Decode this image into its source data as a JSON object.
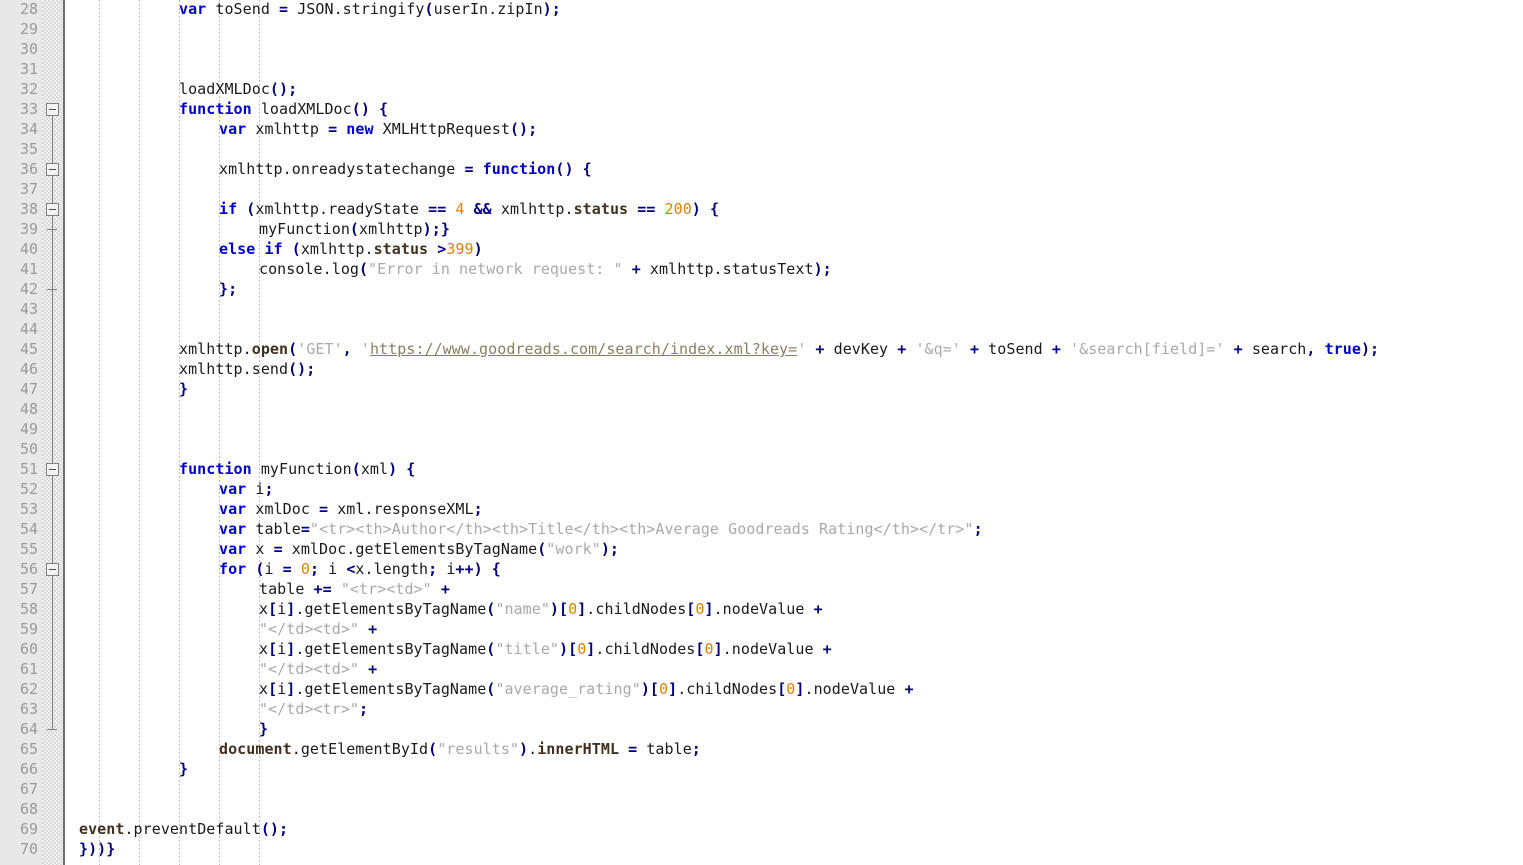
{
  "editor": {
    "kind": "code-editor",
    "language": "javascript",
    "colors": {
      "background": "#ffffff",
      "gutter_background": "#e8e8e8",
      "line_number": "#9a9a9a",
      "keyword": "#0000cc",
      "operator": "#000080",
      "number": "#e08000",
      "string": "#a9a9a9",
      "bold_identifier": "#403020",
      "link": "#8a8060",
      "indent_guide": "#bdbdbd",
      "fold_rail": "#808080"
    },
    "first_line_number": 28,
    "last_line_number": 70,
    "line_height": 20
  },
  "gutter": {
    "line_numbers": [
      28,
      29,
      30,
      31,
      32,
      33,
      34,
      35,
      36,
      37,
      38,
      39,
      40,
      41,
      42,
      43,
      44,
      45,
      46,
      47,
      48,
      49,
      50,
      51,
      52,
      53,
      54,
      55,
      56,
      57,
      58,
      59,
      60,
      61,
      62,
      63,
      64,
      65,
      66,
      67,
      68,
      69,
      70
    ],
    "fold_markers": [
      {
        "line": 33,
        "type": "collapse-box"
      },
      {
        "line": 36,
        "type": "collapse-box"
      },
      {
        "line": 38,
        "type": "collapse-box"
      },
      {
        "line": 39,
        "type": "fold-end-tick"
      },
      {
        "line": 42,
        "type": "fold-end-tick"
      },
      {
        "line": 51,
        "type": "collapse-box"
      },
      {
        "line": 56,
        "type": "collapse-box"
      },
      {
        "line": 64,
        "type": "fold-end-tick"
      }
    ]
  },
  "code": {
    "lines": [
      {
        "n": 28,
        "indent": 0,
        "text": "var toSend = JSON.stringify(userIn.zipIn);"
      },
      {
        "n": 29,
        "indent": 0,
        "text": ""
      },
      {
        "n": 30,
        "indent": 0,
        "text": ""
      },
      {
        "n": 31,
        "indent": 0,
        "text": ""
      },
      {
        "n": 32,
        "indent": 0,
        "text": "loadXMLDoc();"
      },
      {
        "n": 33,
        "indent": 0,
        "text": "function loadXMLDoc() {"
      },
      {
        "n": 34,
        "indent": 1,
        "text": "var xmlhttp = new XMLHttpRequest();"
      },
      {
        "n": 35,
        "indent": 0,
        "text": ""
      },
      {
        "n": 36,
        "indent": 1,
        "text": "xmlhttp.onreadystatechange = function() {"
      },
      {
        "n": 37,
        "indent": 0,
        "text": ""
      },
      {
        "n": 38,
        "indent": 1,
        "text": "if (xmlhttp.readyState == 4 && xmlhttp.status == 200) {"
      },
      {
        "n": 39,
        "indent": 2,
        "text": "myFunction(xmlhttp);}"
      },
      {
        "n": 40,
        "indent": 1,
        "text": "else if (xmlhttp.status >399)"
      },
      {
        "n": 41,
        "indent": 2,
        "text": "console.log(\"Error in network request: \" + xmlhttp.statusText);"
      },
      {
        "n": 42,
        "indent": 1,
        "text": "};"
      },
      {
        "n": 43,
        "indent": 0,
        "text": ""
      },
      {
        "n": 44,
        "indent": 0,
        "text": ""
      },
      {
        "n": 45,
        "indent": 0,
        "text": "xmlhttp.open('GET', 'https://www.goodreads.com/search/index.xml?key=' + devKey + '&q=' + toSend + '&search[field]=' + search, true);"
      },
      {
        "n": 46,
        "indent": 0,
        "text": "xmlhttp.send();"
      },
      {
        "n": 47,
        "indent": 0,
        "text": "}"
      },
      {
        "n": 48,
        "indent": 0,
        "text": ""
      },
      {
        "n": 49,
        "indent": 0,
        "text": ""
      },
      {
        "n": 50,
        "indent": 0,
        "text": ""
      },
      {
        "n": 51,
        "indent": 0,
        "text": "function myFunction(xml) {"
      },
      {
        "n": 52,
        "indent": 1,
        "text": "var i;"
      },
      {
        "n": 53,
        "indent": 1,
        "text": "var xmlDoc = xml.responseXML;"
      },
      {
        "n": 54,
        "indent": 1,
        "text": "var table=\"<tr><th>Author</th><th>Title</th><th>Average Goodreads Rating</th></tr>\";"
      },
      {
        "n": 55,
        "indent": 1,
        "text": "var x = xmlDoc.getElementsByTagName(\"work\");"
      },
      {
        "n": 56,
        "indent": 1,
        "text": "for (i = 0; i <x.length; i++) {"
      },
      {
        "n": 57,
        "indent": 2,
        "text": "table += \"<tr><td>\" +"
      },
      {
        "n": 58,
        "indent": 2,
        "text": "x[i].getElementsByTagName(\"name\")[0].childNodes[0].nodeValue +"
      },
      {
        "n": 59,
        "indent": 2,
        "text": "\"</td><td>\" +"
      },
      {
        "n": 60,
        "indent": 2,
        "text": "x[i].getElementsByTagName(\"title\")[0].childNodes[0].nodeValue +"
      },
      {
        "n": 61,
        "indent": 2,
        "text": "\"</td><td>\" +"
      },
      {
        "n": 62,
        "indent": 2,
        "text": "x[i].getElementsByTagName(\"average_rating\")[0].childNodes[0].nodeValue +"
      },
      {
        "n": 63,
        "indent": 2,
        "text": "\"</td><tr>\";"
      },
      {
        "n": 64,
        "indent": 2,
        "text": "}"
      },
      {
        "n": 65,
        "indent": 1,
        "text": "document.getElementById(\"results\").innerHTML = table;"
      },
      {
        "n": 66,
        "indent": 0,
        "text": "}"
      },
      {
        "n": 67,
        "indent": 0,
        "text": ""
      },
      {
        "n": 68,
        "indent": 0,
        "text": ""
      },
      {
        "n": 69,
        "indent": 0,
        "column": 0,
        "text": "event.preventDefault();"
      },
      {
        "n": 70,
        "indent": 0,
        "column": 0,
        "text": "}))}"
      }
    ]
  },
  "rendered_lines": {
    "l28": [
      [
        "kw",
        "var"
      ],
      [
        "pln",
        " toSend "
      ],
      [
        "op",
        "="
      ],
      [
        "pln",
        " JSON.stringify"
      ],
      [
        "op",
        "("
      ],
      [
        "pln",
        "userIn.zipIn"
      ],
      [
        "op",
        ");"
      ]
    ],
    "l32": [
      [
        "pln",
        "loadXMLDoc"
      ],
      [
        "op",
        "();"
      ]
    ],
    "l33": [
      [
        "kw",
        "function"
      ],
      [
        "pln",
        " loadXMLDoc"
      ],
      [
        "op",
        "()"
      ],
      [
        "pln",
        " "
      ],
      [
        "op",
        "{"
      ]
    ],
    "l34": [
      [
        "kw",
        "var"
      ],
      [
        "pln",
        " xmlhttp "
      ],
      [
        "op",
        "="
      ],
      [
        "pln",
        " "
      ],
      [
        "kw",
        "new"
      ],
      [
        "pln",
        " XMLHttpRequest"
      ],
      [
        "op",
        "();"
      ]
    ],
    "l36": [
      [
        "pln",
        "xmlhttp.onreadystatechange "
      ],
      [
        "op",
        "="
      ],
      [
        "pln",
        " "
      ],
      [
        "kw",
        "function"
      ],
      [
        "op",
        "()"
      ],
      [
        "pln",
        " "
      ],
      [
        "op",
        "{"
      ]
    ],
    "l38": [
      [
        "kw",
        "if"
      ],
      [
        "pln",
        " "
      ],
      [
        "op",
        "("
      ],
      [
        "pln",
        "xmlhttp.readyState "
      ],
      [
        "op",
        "=="
      ],
      [
        "pln",
        " "
      ],
      [
        "num",
        "4"
      ],
      [
        "pln",
        " "
      ],
      [
        "op",
        "&&"
      ],
      [
        "pln",
        " xmlhttp."
      ],
      [
        "bld",
        "status"
      ],
      [
        "pln",
        " "
      ],
      [
        "op",
        "=="
      ],
      [
        "pln",
        " "
      ],
      [
        "num",
        "200"
      ],
      [
        "op",
        ")"
      ],
      [
        "pln",
        " "
      ],
      [
        "op",
        "{"
      ]
    ],
    "l39": [
      [
        "pln",
        "myFunction"
      ],
      [
        "op",
        "("
      ],
      [
        "pln",
        "xmlhttp"
      ],
      [
        "op",
        ");}"
      ]
    ],
    "l40": [
      [
        "kw",
        "else"
      ],
      [
        "pln",
        " "
      ],
      [
        "kw",
        "if"
      ],
      [
        "pln",
        " "
      ],
      [
        "op",
        "("
      ],
      [
        "pln",
        "xmlhttp."
      ],
      [
        "bld",
        "status"
      ],
      [
        "pln",
        " "
      ],
      [
        "op",
        ">"
      ],
      [
        "num",
        "399"
      ],
      [
        "op",
        ")"
      ]
    ],
    "l41": [
      [
        "pln",
        "console.log"
      ],
      [
        "op",
        "("
      ],
      [
        "str",
        "\"Error in network request: \""
      ],
      [
        "pln",
        " "
      ],
      [
        "op",
        "+"
      ],
      [
        "pln",
        " xmlhttp.statusText"
      ],
      [
        "op",
        ");"
      ]
    ],
    "l42": [
      [
        "op",
        "};"
      ]
    ],
    "l45": [
      [
        "pln",
        "xmlhttp."
      ],
      [
        "bld",
        "open"
      ],
      [
        "op",
        "("
      ],
      [
        "str",
        "'GET'"
      ],
      [
        "op",
        ","
      ],
      [
        "pln",
        " "
      ],
      [
        "str",
        "'"
      ],
      [
        "lnk",
        "https://www.goodreads.com/search/index.xml?key="
      ],
      [
        "str",
        "'"
      ],
      [
        "pln",
        " "
      ],
      [
        "op",
        "+"
      ],
      [
        "pln",
        " devKey "
      ],
      [
        "op",
        "+"
      ],
      [
        "pln",
        " "
      ],
      [
        "str",
        "'&q='"
      ],
      [
        "pln",
        " "
      ],
      [
        "op",
        "+"
      ],
      [
        "pln",
        " toSend "
      ],
      [
        "op",
        "+"
      ],
      [
        "pln",
        " "
      ],
      [
        "str",
        "'&search[field]='"
      ],
      [
        "pln",
        " "
      ],
      [
        "op",
        "+"
      ],
      [
        "pln",
        " search"
      ],
      [
        "op",
        ","
      ],
      [
        "pln",
        " "
      ],
      [
        "kw",
        "true"
      ],
      [
        "op",
        ");"
      ]
    ],
    "l46": [
      [
        "pln",
        "xmlhttp.send"
      ],
      [
        "op",
        "();"
      ]
    ],
    "l47": [
      [
        "op",
        "}"
      ]
    ],
    "l51": [
      [
        "kw",
        "function"
      ],
      [
        "pln",
        " myFunction"
      ],
      [
        "op",
        "("
      ],
      [
        "pln",
        "xml"
      ],
      [
        "op",
        ")"
      ],
      [
        "pln",
        " "
      ],
      [
        "op",
        "{"
      ]
    ],
    "l52": [
      [
        "kw",
        "var"
      ],
      [
        "pln",
        " i"
      ],
      [
        "op",
        ";"
      ]
    ],
    "l53": [
      [
        "kw",
        "var"
      ],
      [
        "pln",
        " xmlDoc "
      ],
      [
        "op",
        "="
      ],
      [
        "pln",
        " xml.responseXML"
      ],
      [
        "op",
        ";"
      ]
    ],
    "l54": [
      [
        "kw",
        "var"
      ],
      [
        "pln",
        " table"
      ],
      [
        "op",
        "="
      ],
      [
        "str",
        "\"<tr><th>Author</th><th>Title</th><th>Average Goodreads Rating</th></tr>\""
      ],
      [
        "op",
        ";"
      ]
    ],
    "l55": [
      [
        "kw",
        "var"
      ],
      [
        "pln",
        " x "
      ],
      [
        "op",
        "="
      ],
      [
        "pln",
        " xmlDoc.getElementsByTagName"
      ],
      [
        "op",
        "("
      ],
      [
        "str",
        "\"work\""
      ],
      [
        "op",
        ");"
      ]
    ],
    "l56": [
      [
        "kw",
        "for"
      ],
      [
        "pln",
        " "
      ],
      [
        "op",
        "("
      ],
      [
        "pln",
        "i "
      ],
      [
        "op",
        "="
      ],
      [
        "pln",
        " "
      ],
      [
        "num",
        "0"
      ],
      [
        "op",
        ";"
      ],
      [
        "pln",
        " i "
      ],
      [
        "op",
        "<"
      ],
      [
        "pln",
        "x.length"
      ],
      [
        "op",
        ";"
      ],
      [
        "pln",
        " i"
      ],
      [
        "op",
        "++)"
      ],
      [
        "pln",
        " "
      ],
      [
        "op",
        "{"
      ]
    ],
    "l57": [
      [
        "pln",
        "table "
      ],
      [
        "op",
        "+="
      ],
      [
        "pln",
        " "
      ],
      [
        "str",
        "\"<tr><td>\""
      ],
      [
        "pln",
        " "
      ],
      [
        "op",
        "+"
      ]
    ],
    "l58": [
      [
        "pln",
        "x"
      ],
      [
        "op",
        "["
      ],
      [
        "pln",
        "i"
      ],
      [
        "op",
        "]"
      ],
      [
        "pln",
        ".getElementsByTagName"
      ],
      [
        "op",
        "("
      ],
      [
        "str",
        "\"name\""
      ],
      [
        "op",
        ")["
      ],
      [
        "num",
        "0"
      ],
      [
        "op",
        "]"
      ],
      [
        "pln",
        ".childNodes"
      ],
      [
        "op",
        "["
      ],
      [
        "num",
        "0"
      ],
      [
        "op",
        "]"
      ],
      [
        "pln",
        ".nodeValue "
      ],
      [
        "op",
        "+"
      ]
    ],
    "l59": [
      [
        "str",
        "\"</td><td>\""
      ],
      [
        "pln",
        " "
      ],
      [
        "op",
        "+"
      ]
    ],
    "l60": [
      [
        "pln",
        "x"
      ],
      [
        "op",
        "["
      ],
      [
        "pln",
        "i"
      ],
      [
        "op",
        "]"
      ],
      [
        "pln",
        ".getElementsByTagName"
      ],
      [
        "op",
        "("
      ],
      [
        "str",
        "\"title\""
      ],
      [
        "op",
        ")["
      ],
      [
        "num",
        "0"
      ],
      [
        "op",
        "]"
      ],
      [
        "pln",
        ".childNodes"
      ],
      [
        "op",
        "["
      ],
      [
        "num",
        "0"
      ],
      [
        "op",
        "]"
      ],
      [
        "pln",
        ".nodeValue "
      ],
      [
        "op",
        "+"
      ]
    ],
    "l61": [
      [
        "str",
        "\"</td><td>\""
      ],
      [
        "pln",
        " "
      ],
      [
        "op",
        "+"
      ]
    ],
    "l62": [
      [
        "pln",
        "x"
      ],
      [
        "op",
        "["
      ],
      [
        "pln",
        "i"
      ],
      [
        "op",
        "]"
      ],
      [
        "pln",
        ".getElementsByTagName"
      ],
      [
        "op",
        "("
      ],
      [
        "str",
        "\"average_rating\""
      ],
      [
        "op",
        ")["
      ],
      [
        "num",
        "0"
      ],
      [
        "op",
        "]"
      ],
      [
        "pln",
        ".childNodes"
      ],
      [
        "op",
        "["
      ],
      [
        "num",
        "0"
      ],
      [
        "op",
        "]"
      ],
      [
        "pln",
        ".nodeValue "
      ],
      [
        "op",
        "+"
      ]
    ],
    "l63": [
      [
        "str",
        "\"</td><tr>\""
      ],
      [
        "op",
        ";"
      ]
    ],
    "l64": [
      [
        "op",
        "}"
      ]
    ],
    "l65": [
      [
        "bld",
        "document"
      ],
      [
        "pln",
        ".getElementById"
      ],
      [
        "op",
        "("
      ],
      [
        "str",
        "\"results\""
      ],
      [
        "op",
        ")"
      ],
      [
        "pln",
        "."
      ],
      [
        "bld",
        "innerHTML"
      ],
      [
        "pln",
        " "
      ],
      [
        "op",
        "="
      ],
      [
        "pln",
        " table"
      ],
      [
        "op",
        ";"
      ]
    ],
    "l66": [
      [
        "op",
        "}"
      ]
    ],
    "l69": [
      [
        "bld",
        "event"
      ],
      [
        "pln",
        ".preventDefault"
      ],
      [
        "op",
        "();"
      ]
    ],
    "l70": [
      [
        "op",
        "}))}"
      ]
    ]
  }
}
